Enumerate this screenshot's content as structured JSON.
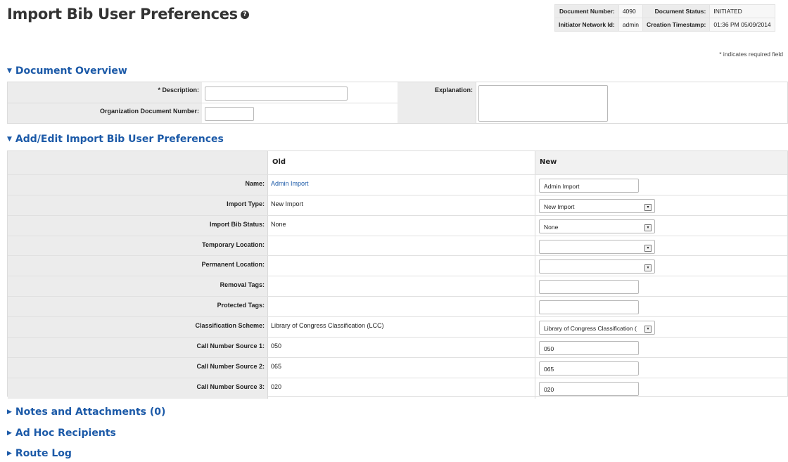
{
  "page": {
    "title": "Import Bib User Preferences",
    "help_icon": "question-circle-icon",
    "required_note": "* indicates required field"
  },
  "doc_info": {
    "number_label": "Document Number:",
    "number": "4090",
    "status_label": "Document Status:",
    "status": "INITIATED",
    "initiator_label": "Initiator Network Id:",
    "initiator": "admin",
    "timestamp_label": "Creation Timestamp:",
    "timestamp": "01:36 PM 05/09/2014"
  },
  "overview": {
    "heading": "Document Overview",
    "description_label": "* Description:",
    "description_value": "",
    "org_doc_label": "Organization Document Number:",
    "org_doc_value": "",
    "explanation_label": "Explanation:",
    "explanation_value": ""
  },
  "edit": {
    "heading": "Add/Edit Import Bib User Preferences",
    "col_old": "Old",
    "col_new": "New",
    "rows": [
      {
        "label": "Name:",
        "old": "Admin Import",
        "new": "Admin Import",
        "type": "text"
      },
      {
        "label": "Import Type:",
        "old": "New Import",
        "new": "New Import",
        "type": "select"
      },
      {
        "label": "Import Bib Status:",
        "old": "None",
        "new": "None",
        "type": "select"
      },
      {
        "label": "Temporary Location:",
        "old": "",
        "new": "",
        "type": "select"
      },
      {
        "label": "Permanent Location:",
        "old": "",
        "new": "",
        "type": "select"
      },
      {
        "label": "Removal Tags:",
        "old": "",
        "new": "",
        "type": "text"
      },
      {
        "label": "Protected Tags:",
        "old": "",
        "new": "",
        "type": "text"
      },
      {
        "label": "Classification Scheme:",
        "old": "Library of Congress Classification (LCC)",
        "new": "Library of Congress Classification (",
        "type": "select"
      },
      {
        "label": "Call Number Source 1:",
        "old": "050",
        "new": "050",
        "type": "text"
      },
      {
        "label": "Call Number Source 2:",
        "old": "065",
        "new": "065",
        "type": "text"
      },
      {
        "label": "Call Number Source 3:",
        "old": "020",
        "new": "020",
        "type": "text"
      }
    ]
  },
  "collapsed_sections": {
    "notes": "Notes and Attachments (0)",
    "adhoc": "Ad Hoc Recipients",
    "route": "Route Log"
  },
  "colors": {
    "accent": "#1c5aa8",
    "label_bg": "#ececec"
  }
}
